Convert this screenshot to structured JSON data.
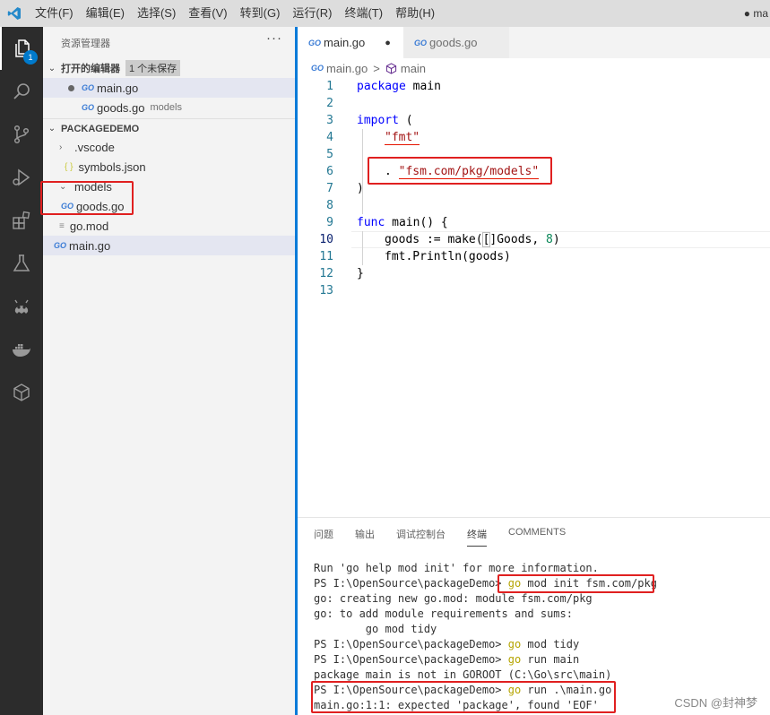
{
  "titlebar": {
    "menu": [
      "文件(F)",
      "编辑(E)",
      "选择(S)",
      "查看(V)",
      "转到(G)",
      "运行(R)",
      "终端(T)",
      "帮助(H)"
    ],
    "window_title": "● ma"
  },
  "activity": {
    "explorer_badge": "1"
  },
  "sidebar": {
    "title": "资源管理器",
    "more": "···",
    "open_editors": {
      "label": "打开的编辑器",
      "unsaved": "1 个未保存",
      "items": [
        {
          "name": "main.go",
          "desc": ""
        },
        {
          "name": "goods.go",
          "desc": "models"
        }
      ]
    },
    "project": {
      "label": "PACKAGEDEMO",
      "items": [
        ".vscode",
        "symbols.json",
        "models",
        "goods.go",
        "go.mod",
        "main.go"
      ]
    },
    "icons": {
      "go": "GO",
      "json": "{ }",
      "mod": "≡"
    }
  },
  "tabs": [
    {
      "name": "main.go",
      "modified": "●"
    },
    {
      "name": "goods.go"
    }
  ],
  "breadcrumb": {
    "file": "main.go",
    "symbol": "main",
    "sep": ">"
  },
  "editor": {
    "line_numbers": [
      "1",
      "2",
      "3",
      "4",
      "5",
      "6",
      "7",
      "8",
      "9",
      "10",
      "11",
      "12",
      "13"
    ],
    "l1": {
      "kw": "package",
      "rest": " main"
    },
    "l3": {
      "kw": "import",
      "rest": " ("
    },
    "l4": {
      "str": "\"fmt\""
    },
    "l6": {
      "pre": ". ",
      "str": "\"fsm.com/pkg/models\""
    },
    "l7": ")",
    "l9": {
      "kw": "func",
      "rest": " main() {"
    },
    "l10": {
      "a": "goods := make(",
      "b": "[",
      "c": "]",
      "d": "Goods, ",
      "num": "8",
      "e": ")"
    },
    "l11": "fmt.Println(goods)",
    "l12": "}"
  },
  "panel": {
    "tabs": [
      "问题",
      "输出",
      "调试控制台",
      "终端",
      "COMMENTS"
    ],
    "terminal": {
      "t1": "Run 'go help mod init' for more information.",
      "t2a": "PS I:\\OpenSource\\packageDemo> ",
      "t2b": "go",
      "t2c": " mod init fsm.com/pkg",
      "t3": "go: creating new go.mod: module fsm.com/pkg",
      "t4": "go: to add module requirements and sums:",
      "t5": "        go mod tidy",
      "t6a": "PS I:\\OpenSource\\packageDemo> ",
      "t6b": "go",
      "t6c": " mod tidy",
      "t7a": "PS I:\\OpenSource\\packageDemo> ",
      "t7b": "go",
      "t7c": " run main",
      "t8": "package main is not in GOROOT (C:\\Go\\src\\main)",
      "t9a": "PS I:\\OpenSource\\packageDemo> ",
      "t9b": "go",
      "t9c": " run .\\main.go",
      "t10": "main.go:1:1: expected 'package', found 'EOF'"
    }
  },
  "watermark": "CSDN @封神梦"
}
